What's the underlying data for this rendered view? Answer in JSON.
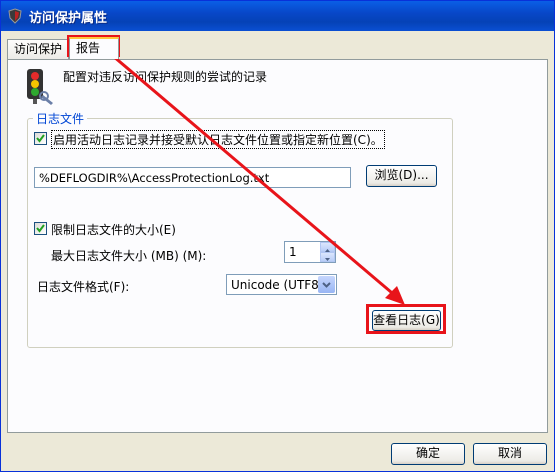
{
  "window": {
    "title": "访问保护属性",
    "icon": "shield-icon"
  },
  "tabs": [
    {
      "label": "访问保护"
    },
    {
      "label": "报告"
    }
  ],
  "description": "配置对违反访问保护规则的尝试的记录",
  "log_group": {
    "label": "日志文件",
    "enable_log_label": "启用活动日志记录并接受默认日志文件位置或指定新位置(C)。",
    "enable_log_checked": true,
    "path_value": "%DEFLOGDIR%\\AccessProtectionLog.txt",
    "browse_label": "浏览(D)...",
    "limit_size_label": "限制日志文件的大小(E)",
    "limit_size_checked": true,
    "max_size_label": "最大日志文件大小 (MB) (M):",
    "max_size_value": "1",
    "format_label": "日志文件格式(F):",
    "format_value": "Unicode (UTF8)",
    "view_log_label": "查看日志(G)"
  },
  "buttons": {
    "ok": "确定",
    "cancel": "取消"
  },
  "colors": {
    "annotation": "#e8141a",
    "titlebar": "#0a5fe6"
  }
}
